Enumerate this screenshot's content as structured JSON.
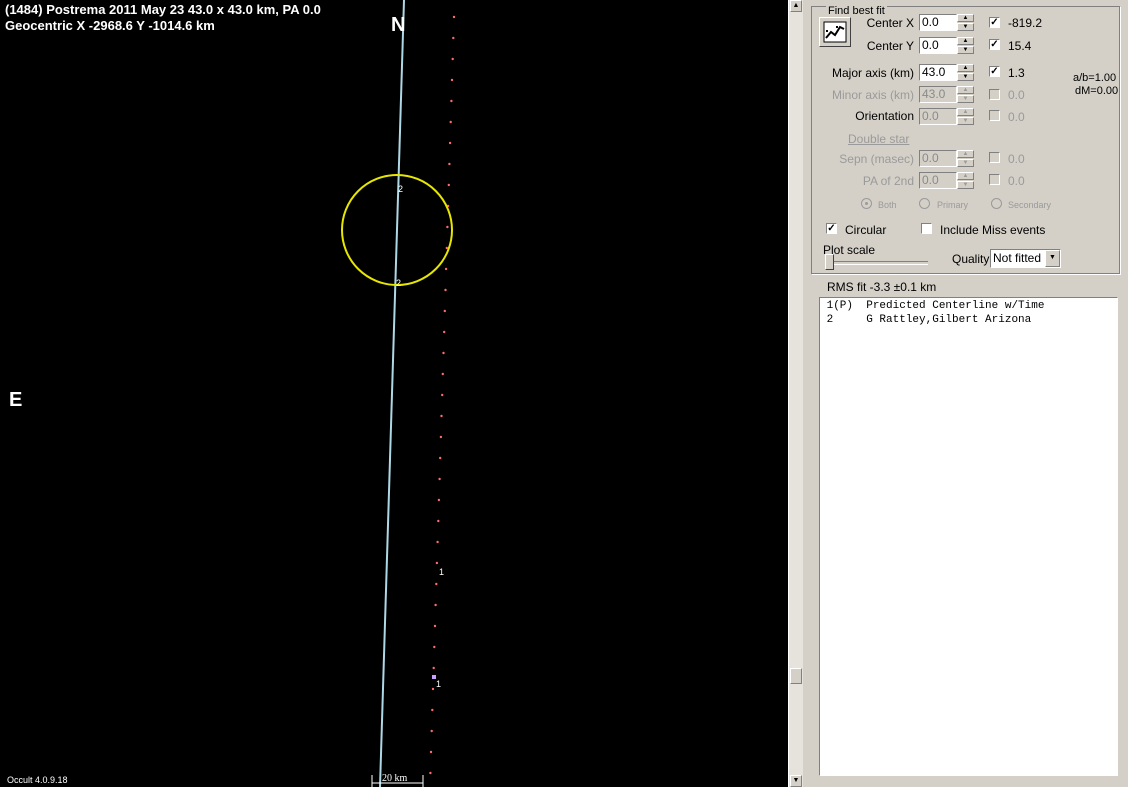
{
  "plot": {
    "title_line1": "(1484) Postrema  2011 May 23  43.0 x 43.0 km, PA 0.0",
    "title_line2": "Geocentric  X  -2968.6  Y -1014.6 km",
    "north_label": "N",
    "east_label": "E",
    "chord_label_top": "2",
    "chord_label_bottom": "2",
    "predicted_label_1": "1",
    "predicted_label_2": "1",
    "scale_label": "20 km",
    "version": "Occult 4.0.9.18",
    "outline_color": "#e6e600",
    "chord_color": "#add8e6",
    "dot_color": "#ff6b6b"
  },
  "panel": {
    "group_title": "Find best fit",
    "fit_icon": "chart-fit-icon",
    "center_x": {
      "label": "Center X",
      "value": "0.0",
      "checked": true,
      "result": "-819.2"
    },
    "center_y": {
      "label": "Center Y",
      "value": "0.0",
      "checked": true,
      "result": "15.4"
    },
    "major_axis": {
      "label": "Major axis (km)",
      "value": "43.0",
      "checked": true,
      "result": "1.3"
    },
    "minor_axis": {
      "label": "Minor axis (km)",
      "value": "43.0",
      "checked": false,
      "result": "0.0"
    },
    "orientation": {
      "label": "Orientation",
      "value": "0.0",
      "checked": false,
      "result": "0.0"
    },
    "ab_ratio": "a/b=1.00",
    "dm": "dM=0.00",
    "double_star": "Double star",
    "sepn": {
      "label": "Sepn (masec)",
      "value": "0.0",
      "checked": false,
      "result": "0.0"
    },
    "pa2": {
      "label": "PA of 2nd",
      "value": "0.0",
      "checked": false,
      "result": "0.0"
    },
    "radio_both": "Both",
    "radio_primary": "Primary",
    "radio_secondary": "Secondary",
    "circular_label": "Circular",
    "circular_checked": true,
    "include_miss_label": "Include Miss events",
    "include_miss_checked": false,
    "plot_scale_label": "Plot scale",
    "quality_label": "Quality",
    "quality_value": "Not fitted",
    "rms_fit": "RMS fit -3.3 ±0.1 km",
    "events": [
      {
        "num": " 1(P)",
        "name": "Predicted Centerline w/Time"
      },
      {
        "num": " 2   ",
        "name": "G Rattley,Gilbert Arizona"
      }
    ]
  }
}
